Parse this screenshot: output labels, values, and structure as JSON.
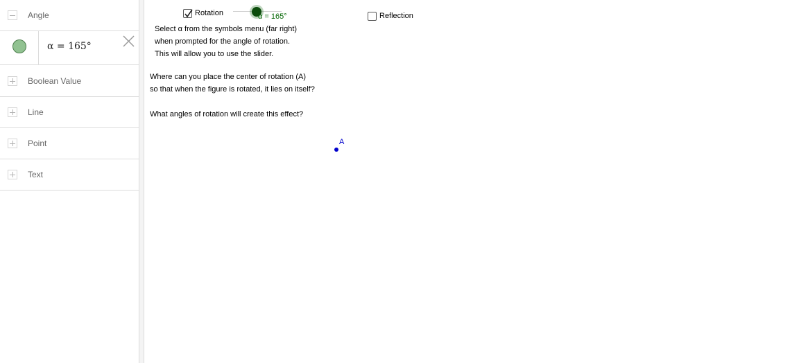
{
  "algebra": {
    "categories": {
      "angle": "Angle",
      "boolean": "Boolean Value",
      "line": "Line",
      "point": "Point",
      "text": "Text"
    },
    "angle_item": {
      "formula": "α = 165°",
      "color": "#91c291"
    }
  },
  "graphics": {
    "rotation_checkbox": {
      "label": "Rotation",
      "checked": true
    },
    "reflection_checkbox": {
      "label": "Reflection",
      "checked": false
    },
    "slider": {
      "label": "α = 165°",
      "value_degrees": 165,
      "color": "#006400"
    },
    "instructions": [
      "Select α from the symbols menu (far right)",
      "when prompted for the angle of rotation.",
      "This will allow you to use the slider."
    ],
    "question1": [
      "Where can you place the center of rotation (A)",
      "so that when the figure is rotated, it lies on itself?"
    ],
    "question2": "What angles of rotation will create this effect?",
    "point_a": {
      "label": "A",
      "color": "#0000cc"
    }
  }
}
